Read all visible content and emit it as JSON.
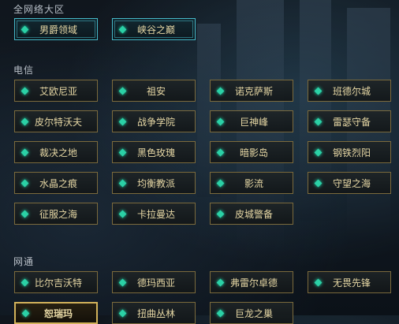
{
  "sections": [
    {
      "title": "全网络大区",
      "servers": [
        {
          "name": "男爵领域",
          "style": "teal"
        },
        {
          "name": "峡谷之巅",
          "style": "teal"
        }
      ]
    },
    {
      "title": "电信",
      "servers": [
        {
          "name": "艾欧尼亚"
        },
        {
          "name": "祖安"
        },
        {
          "name": "诺克萨斯"
        },
        {
          "name": "班德尔城"
        },
        {
          "name": "皮尔特沃夫"
        },
        {
          "name": "战争学院"
        },
        {
          "name": "巨神峰"
        },
        {
          "name": "雷瑟守备"
        },
        {
          "name": "裁决之地"
        },
        {
          "name": "黑色玫瑰"
        },
        {
          "name": "暗影岛"
        },
        {
          "name": "钢铁烈阳"
        },
        {
          "name": "水晶之痕"
        },
        {
          "name": "均衡教派"
        },
        {
          "name": "影流"
        },
        {
          "name": "守望之海"
        },
        {
          "name": "征服之海"
        },
        {
          "name": "卡拉曼达"
        },
        {
          "name": "皮城警备"
        }
      ]
    },
    {
      "title": "网通",
      "servers": [
        {
          "name": "比尔吉沃特"
        },
        {
          "name": "德玛西亚"
        },
        {
          "name": "弗雷尔卓德"
        },
        {
          "name": "无畏先锋"
        },
        {
          "name": "恕瑞玛",
          "style": "gold"
        },
        {
          "name": "扭曲丛林"
        },
        {
          "name": "巨龙之巢"
        }
      ]
    }
  ],
  "colors": {
    "gem": "#2bd1a6",
    "border_gold": "#7b6a3c",
    "border_teal": "#46b9c9",
    "selected": "#d2b25a"
  }
}
